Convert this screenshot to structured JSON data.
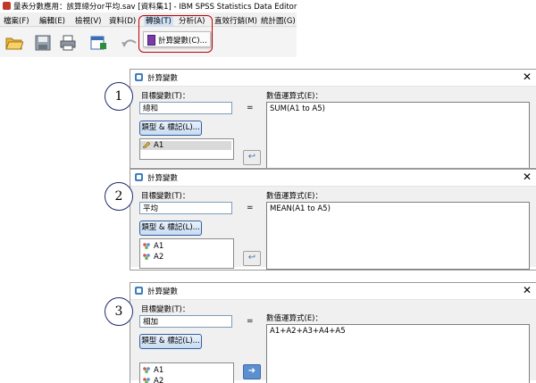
{
  "spss_window": {
    "title": "量表分數應用：該算總分or平均.sav [資料集1] - IBM SPSS Statistics Data Editor",
    "menu": [
      "檔案(F)",
      "編輯(E)",
      "檢視(V)",
      "資料(D)",
      "轉換(T)",
      "分析(A)",
      "直效行銷(M)",
      "統計圖(G)"
    ],
    "dropdown_item": "計算變數(C)..."
  },
  "dialogs": [
    {
      "step": "1",
      "title": "計算變數",
      "target_label": "目標變數(T)：",
      "target_value": "總和",
      "equals": "=",
      "type_label_button": "類型 & 標記(L)...",
      "variables": [
        "A1"
      ],
      "expression_label": "數值運算式(E)：",
      "expression": "SUM(A1 to A5)"
    },
    {
      "step": "2",
      "title": "計算變數",
      "target_label": "目標變數(T)：",
      "target_value": "平均",
      "equals": "=",
      "type_label_button": "類型 & 標記(L)...",
      "variables": [
        "A1",
        "A2"
      ],
      "expression_label": "數值運算式(E)：",
      "expression": "MEAN(A1 to A5)"
    },
    {
      "step": "3",
      "title": "計算變數",
      "target_label": "目標變數(T)：",
      "target_value": "相加",
      "equals": "=",
      "type_label_button": "類型 & 標記(L)...",
      "variables": [
        "A1",
        "A2"
      ],
      "expression_label": "數值運算式(E)：",
      "expression": "A1+A2+A3+A4+A5"
    }
  ],
  "colors": {
    "highlight_box": "#c00000",
    "step_circle": "#1f2b6e",
    "menu_active": "#cfe3f7"
  }
}
